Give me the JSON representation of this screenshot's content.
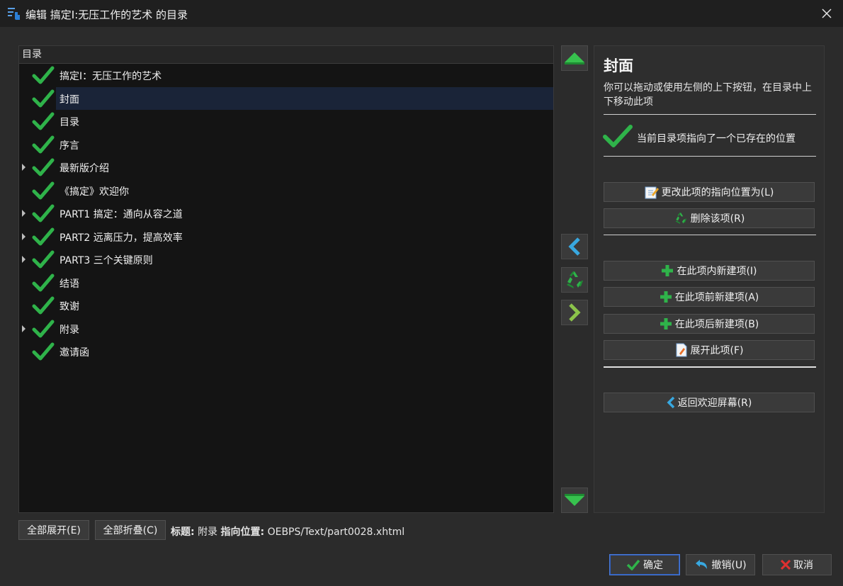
{
  "window": {
    "title": "编辑 搞定I:无压工作的艺术 的目录",
    "close_icon": "close-icon"
  },
  "tree": {
    "header": "目录",
    "items": [
      {
        "label": "搞定I：无压工作的艺术",
        "expandable": false,
        "selected": false
      },
      {
        "label": "封面",
        "expandable": false,
        "selected": true
      },
      {
        "label": "目录",
        "expandable": false,
        "selected": false
      },
      {
        "label": "序言",
        "expandable": false,
        "selected": false
      },
      {
        "label": "最新版介绍",
        "expandable": true,
        "selected": false
      },
      {
        "label": "《搞定》欢迎你",
        "expandable": false,
        "selected": false
      },
      {
        "label": "PART1 搞定：通向从容之道",
        "expandable": true,
        "selected": false
      },
      {
        "label": "PART2 远离压力，提高效率",
        "expandable": true,
        "selected": false
      },
      {
        "label": "PART3 三个关键原则",
        "expandable": true,
        "selected": false
      },
      {
        "label": "结语",
        "expandable": false,
        "selected": false
      },
      {
        "label": "致谢",
        "expandable": false,
        "selected": false
      },
      {
        "label": "附录",
        "expandable": true,
        "selected": false
      },
      {
        "label": "邀请函",
        "expandable": false,
        "selected": false
      }
    ]
  },
  "side_buttons": {
    "up_icon": "move-up-icon",
    "left_icon": "indent-left-icon",
    "delete_icon": "recycle-icon",
    "right_icon": "indent-right-icon",
    "down_icon": "move-down-icon"
  },
  "details": {
    "title": "封面",
    "description": "你可以拖动或使用左侧的上下按钮，在目录中上下移动此项",
    "status": "当前目录项指向了一个已存在的位置",
    "buttons": {
      "change_location": "更改此项的指向位置为(L)",
      "remove": "删除该项(R)",
      "new_inside": "在此项内新建项(I)",
      "new_before": "在此项前新建项(A)",
      "new_after": "在此项后新建项(B)",
      "flatten": "展开此项(F)",
      "back": "返回欢迎屏幕(R)"
    }
  },
  "bottom": {
    "expand_all": "全部展开(E)",
    "collapse_all": "全部折叠(C)",
    "title_label": "标题:",
    "title_value": "附录",
    "location_label": "指向位置:",
    "location_value": "OEBPS/Text/part0028.xhtml"
  },
  "dialog": {
    "ok": "确定",
    "undo": "撤销(U)",
    "cancel": "取消"
  },
  "colors": {
    "check_green": "#2fb34a",
    "accent_blue": "#4a7bd8",
    "selected_row": "#1a2438"
  }
}
